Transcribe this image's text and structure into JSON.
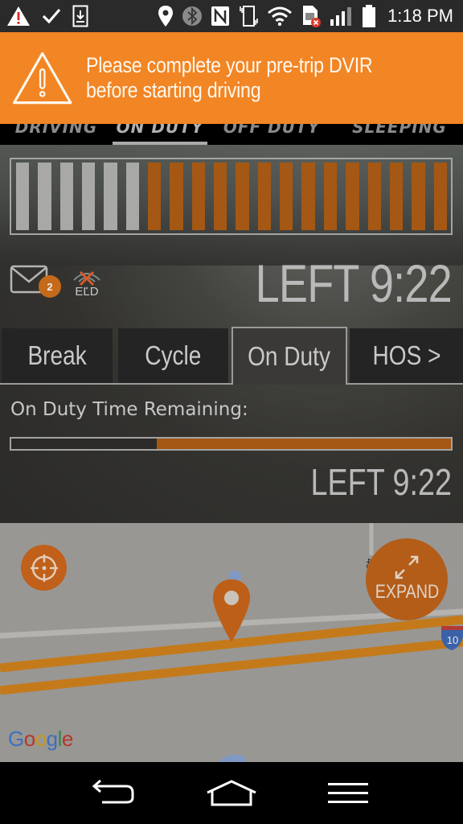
{
  "status_bar": {
    "left_icons": [
      "warning-icon",
      "check-icon",
      "download-icon"
    ],
    "right_icons": [
      "location-icon",
      "bluetooth-icon",
      "nfc-icon",
      "vibrate-icon",
      "wifi-icon",
      "sim-error-icon",
      "signal-icon",
      "battery-icon"
    ],
    "time": "1:18 PM"
  },
  "alert": {
    "icon": "warning-triangle-icon",
    "message": "Please complete your pre-trip DVIR before starting driving",
    "color": "#f28524"
  },
  "duty_status": {
    "tabs": [
      {
        "label": "DRIVING",
        "active": false
      },
      {
        "label": "ON DUTY",
        "active": true
      },
      {
        "label": "OFF DUTY",
        "active": false
      },
      {
        "label": "SLEEPING",
        "active": false
      }
    ]
  },
  "hours_segments": {
    "total": 20,
    "used": 6,
    "remaining": 14,
    "used_color": "#a8a8a6",
    "remaining_color": "#a45814"
  },
  "messages": {
    "icon": "mail-icon",
    "unread_count": "2"
  },
  "eld": {
    "icon": "eld-disconnected-icon",
    "label": "ELD"
  },
  "header_time_left": "LEFT 9:22",
  "clock_tabs": [
    {
      "label": "Break",
      "active": false
    },
    {
      "label": "Cycle",
      "active": false
    },
    {
      "label": "On Duty",
      "active": true
    },
    {
      "label": "HOS >",
      "active": false
    }
  ],
  "on_duty_panel": {
    "label": "On Duty Time Remaining:",
    "remaining_fraction": 0.67,
    "time_left": "LEFT 9:22"
  },
  "map": {
    "locate_button_icon": "crosshair-icon",
    "expand_button_label": "EXPAND",
    "expand_icon": "expand-arrows-icon",
    "highway_shield": "10",
    "road_label": "45",
    "attribution": "Google",
    "marker_icon": "location-pin-icon"
  },
  "nav_bar": {
    "buttons": [
      "back-icon",
      "home-icon",
      "menu-icon"
    ]
  }
}
